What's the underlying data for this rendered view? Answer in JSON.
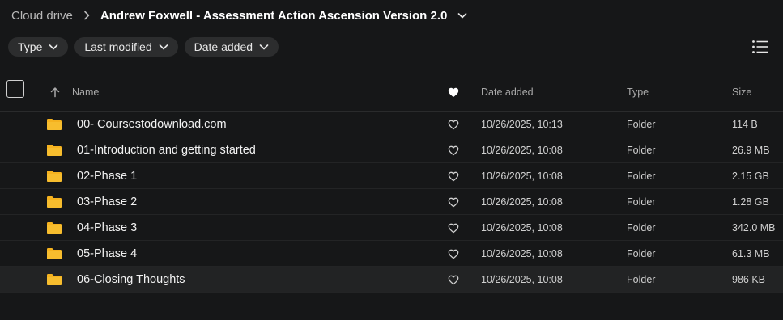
{
  "breadcrumb": {
    "root": "Cloud drive",
    "current": "Andrew Foxwell - Assessment Action Ascension Version 2.0"
  },
  "filters": [
    {
      "label": "Type"
    },
    {
      "label": "Last modified"
    },
    {
      "label": "Date added"
    }
  ],
  "columns": {
    "name": "Name",
    "date_added": "Date added",
    "type": "Type",
    "size": "Size"
  },
  "rows": [
    {
      "name": "00- Coursestodownload.com",
      "date": "10/26/2025, 10:13",
      "type": "Folder",
      "size": "114 B"
    },
    {
      "name": "01-Introduction and getting started",
      "date": "10/26/2025, 10:08",
      "type": "Folder",
      "size": "26.9 MB"
    },
    {
      "name": "02-Phase 1",
      "date": "10/26/2025, 10:08",
      "type": "Folder",
      "size": "2.15 GB"
    },
    {
      "name": "03-Phase 2",
      "date": "10/26/2025, 10:08",
      "type": "Folder",
      "size": "1.28 GB"
    },
    {
      "name": "04-Phase 3",
      "date": "10/26/2025, 10:08",
      "type": "Folder",
      "size": "342.0 MB"
    },
    {
      "name": "05-Phase 4",
      "date": "10/26/2025, 10:08",
      "type": "Folder",
      "size": "61.3 MB"
    },
    {
      "name": "06-Closing Thoughts",
      "date": "10/26/2025, 10:08",
      "type": "Folder",
      "size": "986 KB"
    }
  ],
  "colors": {
    "background": "#161718",
    "folder": "#f5b21f",
    "chip": "#2c2d2e",
    "row_hover": "#222324"
  },
  "icons": {
    "breadcrumb_separator": "chevron-right-icon",
    "dropdown": "chevron-down-icon",
    "view_toggle": "list-view-icon",
    "sort": "arrow-up-icon",
    "favorite_header": "heart-filled-icon",
    "favorite": "heart-outline-icon",
    "folder": "folder-icon"
  }
}
